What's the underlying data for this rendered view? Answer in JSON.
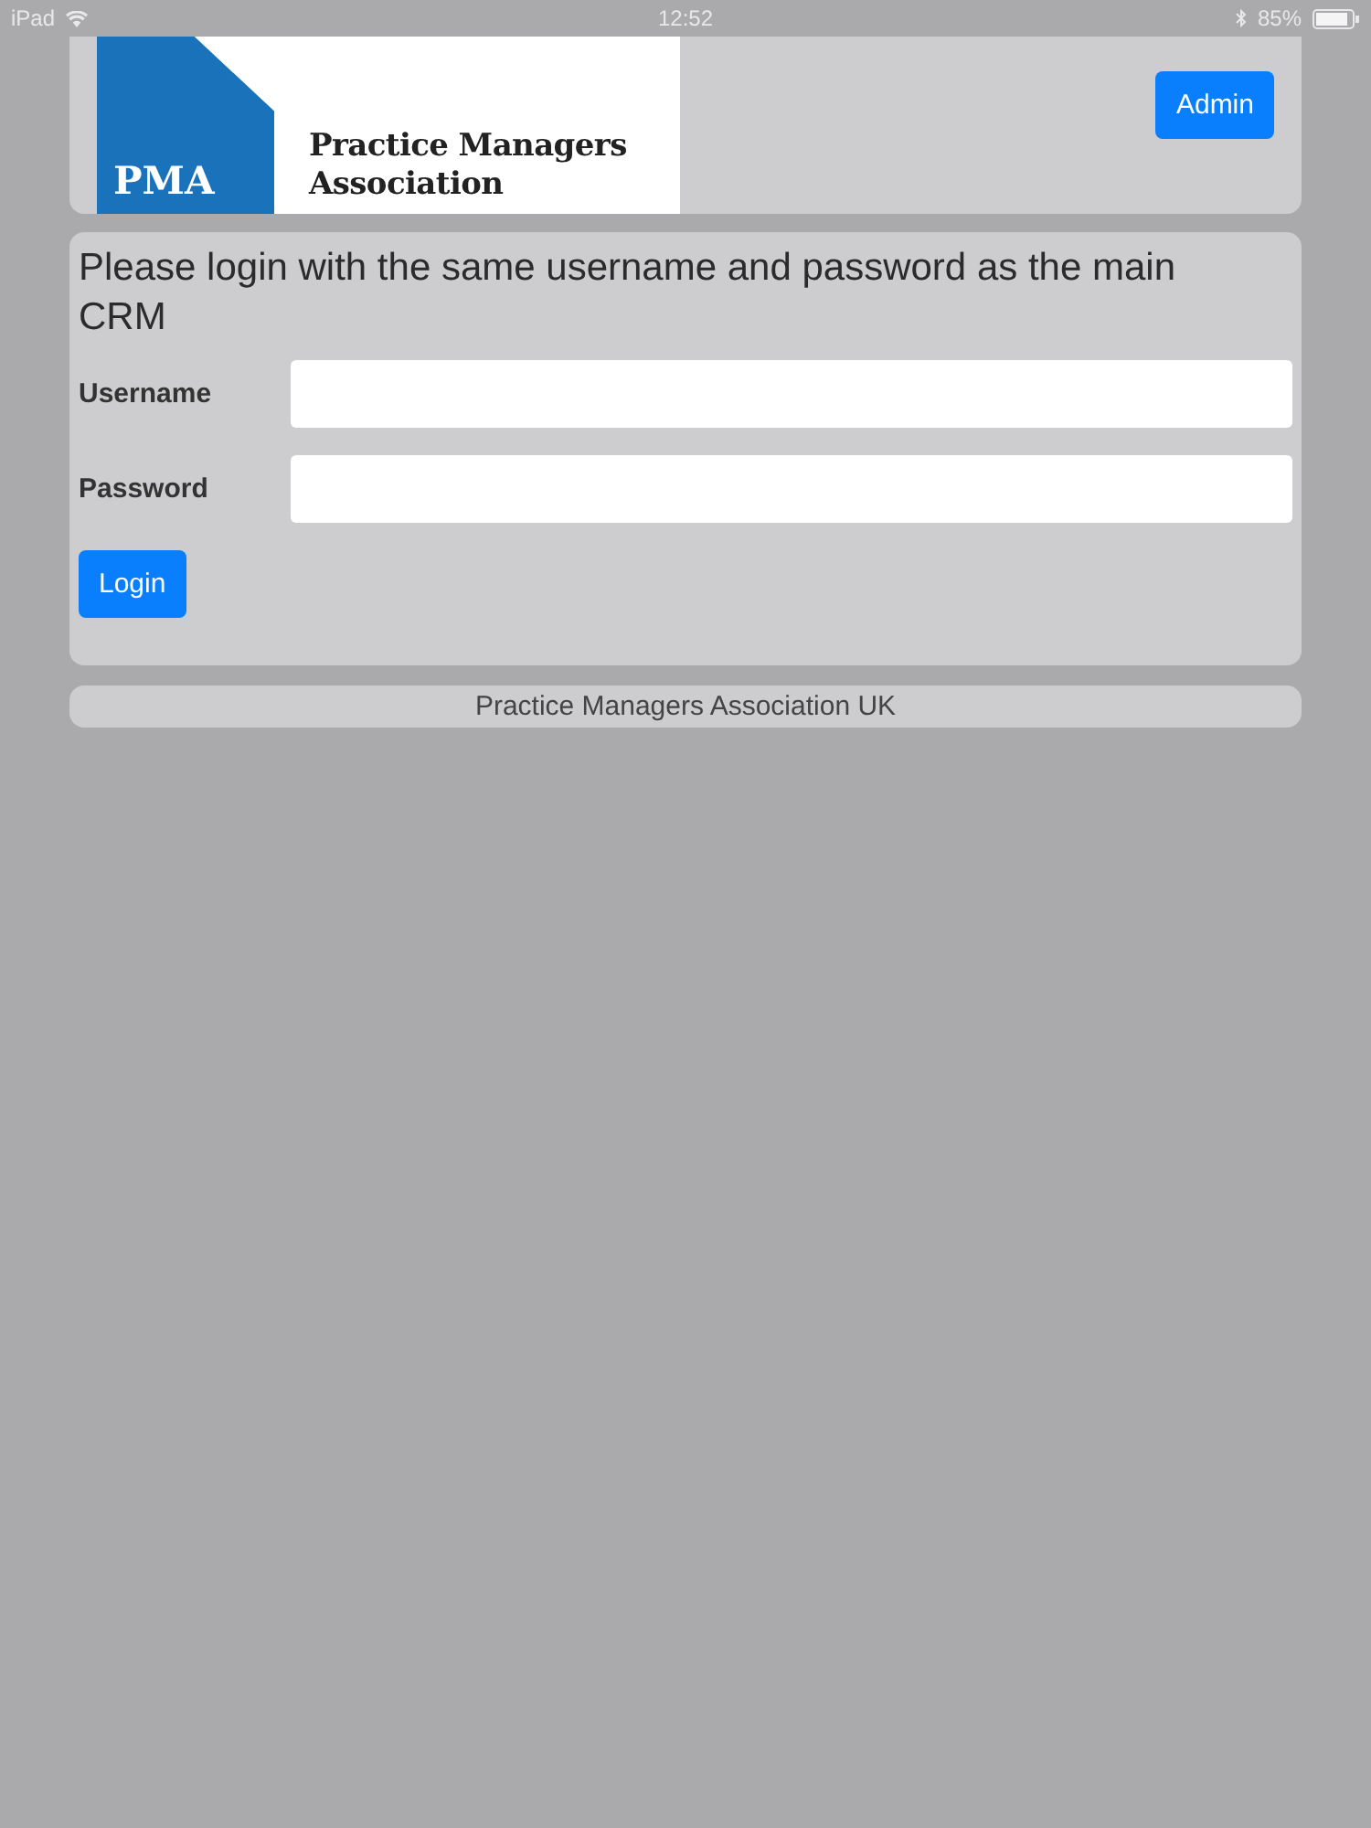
{
  "status_bar": {
    "device": "iPad",
    "time": "12:52",
    "battery": "85%"
  },
  "header": {
    "logo": {
      "mark": "PMA",
      "name_lines": [
        "Practice Managers",
        "Association"
      ]
    },
    "admin_button": "Admin"
  },
  "login": {
    "prompt": "Please login with the same username and password as the main CRM",
    "fields": [
      {
        "label": "Username"
      },
      {
        "label": "Password"
      }
    ],
    "button": "Login"
  },
  "footer": "Practice Managers Association UK"
}
